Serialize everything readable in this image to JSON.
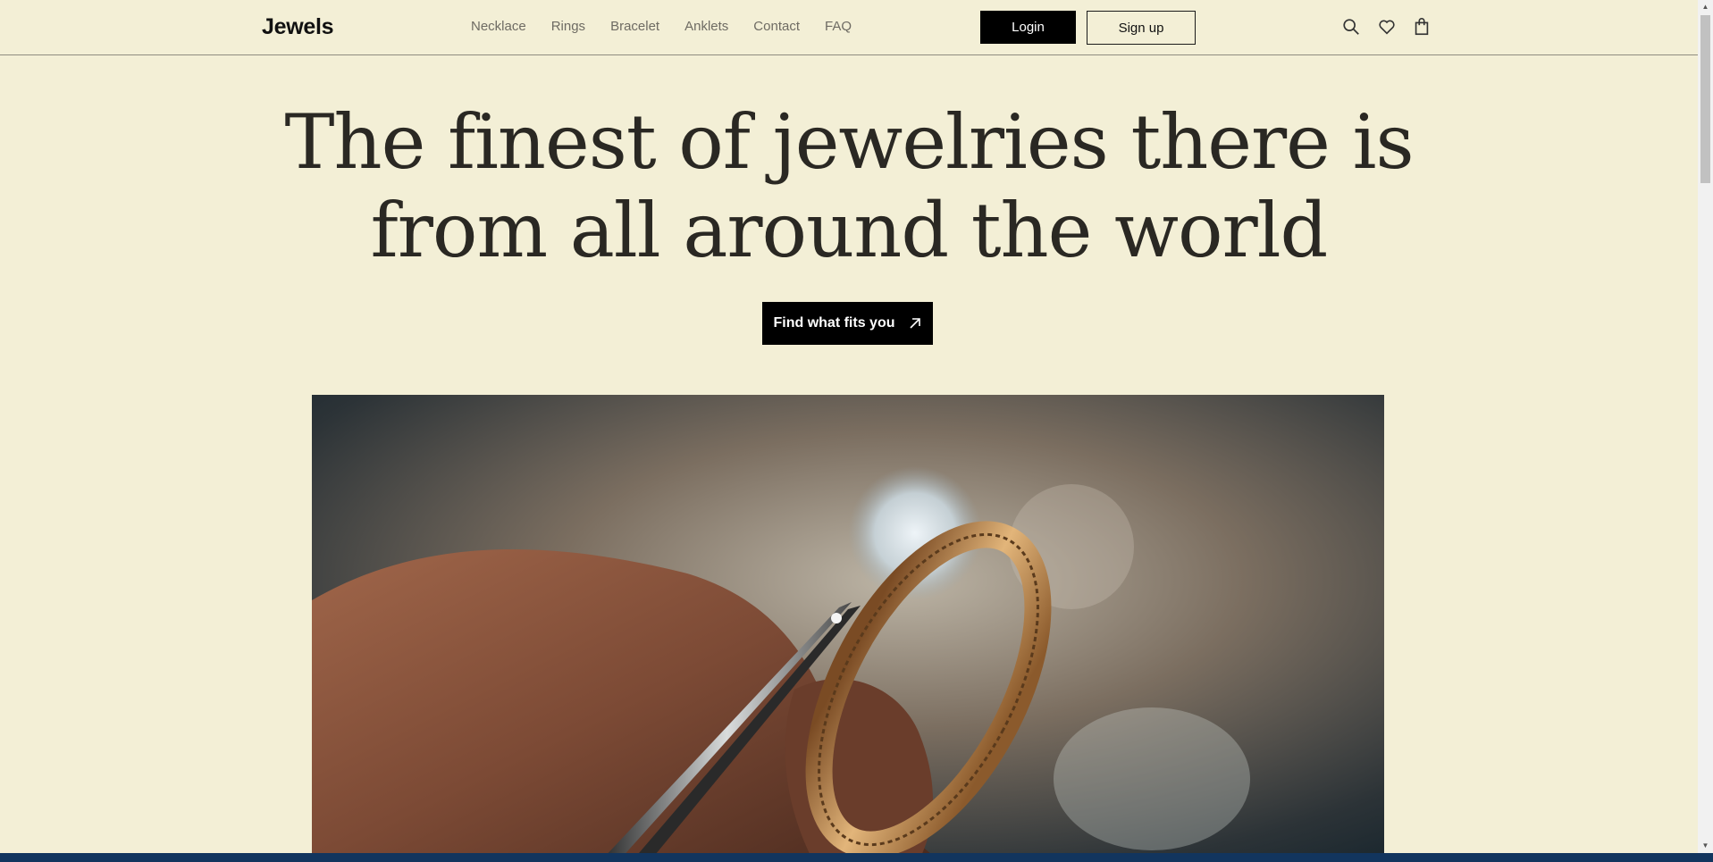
{
  "header": {
    "logo": "Jewels",
    "nav": [
      "Necklace",
      "Rings",
      "Bracelet",
      "Anklets",
      "Contact",
      "FAQ"
    ],
    "login_label": "Login",
    "signup_label": "Sign up",
    "icons": [
      "search-icon",
      "heart-icon",
      "shopping-bag-icon"
    ]
  },
  "hero": {
    "title_line1": "The finest of jewelries there is",
    "title_line2": "from all around the world",
    "cta_label": "Find what fits you",
    "cta_icon": "arrow-up-right-icon"
  },
  "image": {
    "subject": "hand holding gold ring with tweezers"
  }
}
